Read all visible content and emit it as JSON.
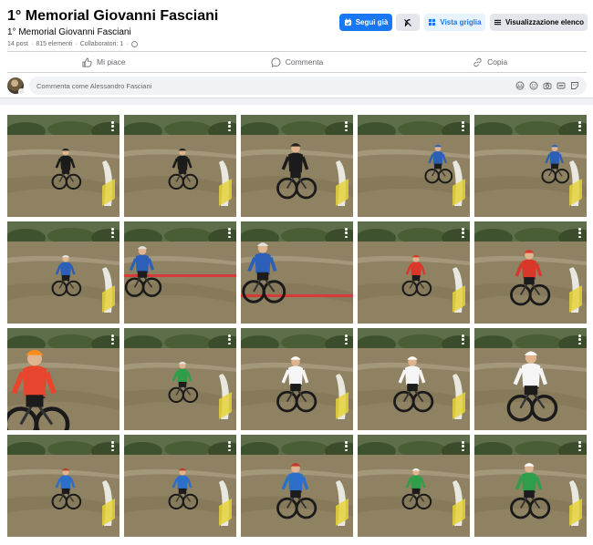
{
  "album": {
    "title": "1° Memorial Giovanni Fasciani",
    "subtitle": "1° Memorial Giovanni Fasciani",
    "posts": "14 post",
    "elements": "815 elementi",
    "collaborators": "Collaboratori: 1",
    "separator": "·"
  },
  "toolbar": {
    "follow_label": "Segui già",
    "grid_label": "Vista griglia",
    "list_label": "Visualizzazione elenco",
    "follow_icon": "calendar-check-icon",
    "extra_icon": "feather-off-icon",
    "grid_icon": "grid-icon",
    "list_icon": "list-icon"
  },
  "actions": [
    {
      "label": "Mi piace",
      "icon": "thumbs-up-icon"
    },
    {
      "label": "Commenta",
      "icon": "comment-bubble-icon"
    },
    {
      "label": "Copia",
      "icon": "link-icon"
    }
  ],
  "comment": {
    "placeholder": "Commenta come Alessandro Fasciani",
    "icons": [
      "avatar-sticker-icon",
      "emoji-icon",
      "camera-icon",
      "gif-icon",
      "sticker-icon"
    ]
  },
  "colors": {
    "primary": "#1877f2",
    "grid_tint": "#e7f3ff",
    "button_grey": "#e4e6eb",
    "background": "#f0f2f5",
    "secondary_text": "#65676b"
  },
  "photos": [
    {
      "jersey": "#1b1b1b",
      "helmet": "#222222",
      "scene": "far-center"
    },
    {
      "jersey": "#1b1b1b",
      "helmet": "#222222",
      "scene": "far-center"
    },
    {
      "jersey": "#1b1b1b",
      "helmet": "#222222",
      "scene": "near-center"
    },
    {
      "jersey": "#2c5fb8",
      "helmet": "#2c5fb8",
      "scene": "far-right"
    },
    {
      "jersey": "#2c5fb8",
      "helmet": "#2c5fb8",
      "scene": "far-right"
    },
    {
      "jersey": "#2c5fb8",
      "helmet": "#e0e0e0",
      "scene": "far-center"
    },
    {
      "jersey": "#2c5fb8",
      "helmet": "#e0e0e0",
      "scene": "tape-left"
    },
    {
      "jersey": "#2c5fb8",
      "helmet": "#e0e0e0",
      "scene": "tape-near"
    },
    {
      "jersey": "#d9372a",
      "helmet": "#d9372a",
      "scene": "far-center"
    },
    {
      "jersey": "#d9372a",
      "helmet": "#d9372a",
      "scene": "near-center"
    },
    {
      "jersey": "#e8452e",
      "helmet": "#ff8c1a",
      "scene": "close-left"
    },
    {
      "jersey": "#2e9e4b",
      "helmet": "#e8e8e8",
      "scene": "far-center"
    },
    {
      "jersey": "#f5f5f5",
      "helmet": "#ffffff",
      "scene": "near-center"
    },
    {
      "jersey": "#f5f5f5",
      "helmet": "#ffffff",
      "scene": "near-center"
    },
    {
      "jersey": "#f5f5f5",
      "helmet": "#ffffff",
      "scene": "close-center"
    },
    {
      "jersey": "#2c6fc8",
      "helmet": "#c0392b",
      "scene": "far-center"
    },
    {
      "jersey": "#2c6fc8",
      "helmet": "#c0392b",
      "scene": "far-center"
    },
    {
      "jersey": "#2c6fc8",
      "helmet": "#c0392b",
      "scene": "near-center"
    },
    {
      "jersey": "#2e9e4b",
      "helmet": "#ffffff",
      "scene": "far-center"
    },
    {
      "jersey": "#2e9e4b",
      "helmet": "#ffffff",
      "scene": "near-center"
    }
  ]
}
